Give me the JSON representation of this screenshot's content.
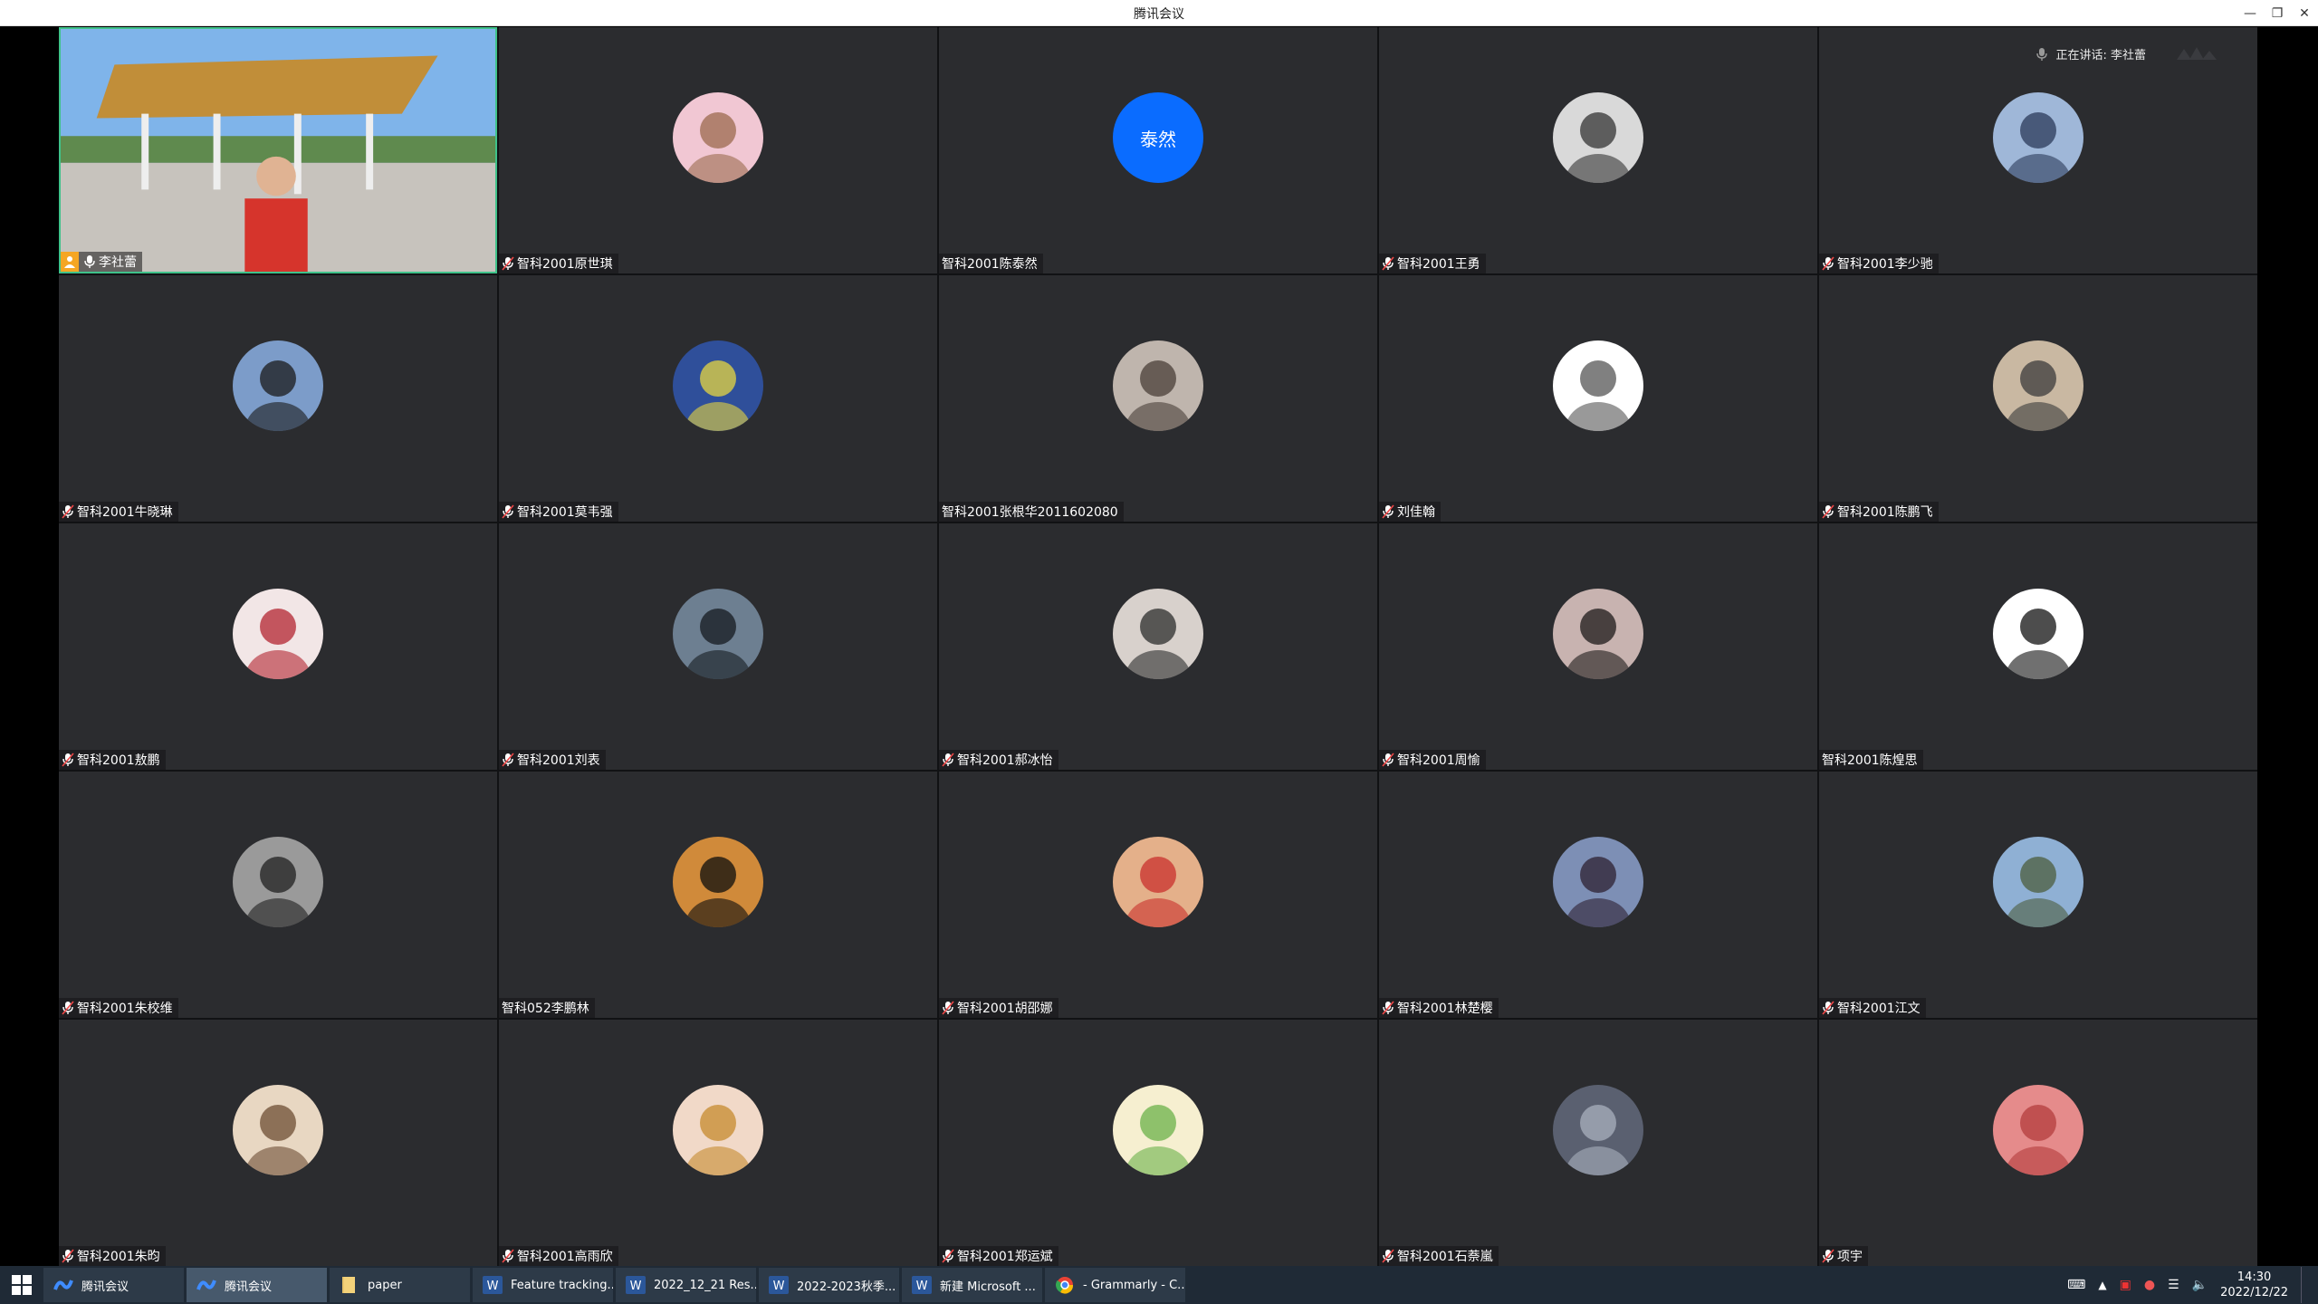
{
  "window": {
    "title": "腾讯会议"
  },
  "speaking": {
    "label": "正在讲话: 李社蕾"
  },
  "participants": [
    {
      "name": "李社蕾",
      "kind": "video",
      "host": true,
      "mic": true
    },
    {
      "name": "智科2001原世琪",
      "kind": "avatar",
      "mic": true,
      "colors": [
        "#f1c7d3",
        "#9b6a4e"
      ]
    },
    {
      "name": "智科2001陈泰然",
      "kind": "text",
      "mic": false,
      "initials": "泰然"
    },
    {
      "name": "智科2001王勇",
      "kind": "avatar",
      "mic": true,
      "colors": [
        "#d9d9d9",
        "#333333"
      ]
    },
    {
      "name": "智科2001李少驰",
      "kind": "avatar",
      "mic": true,
      "colors": [
        "#9fb7d8",
        "#2b3a5a"
      ]
    },
    {
      "name": "智科2001牛晓琳",
      "kind": "avatar",
      "mic": true,
      "colors": [
        "#7c9cc9",
        "#1b1b1b"
      ]
    },
    {
      "name": "智科2001莫韦强",
      "kind": "avatar",
      "mic": true,
      "colors": [
        "#2f4f9a",
        "#e7d640"
      ]
    },
    {
      "name": "智科2001张根华2011602080",
      "kind": "avatar",
      "mic": false,
      "colors": [
        "#bfb5ad",
        "#4a3f38"
      ]
    },
    {
      "name": "刘佳翰",
      "kind": "avatar",
      "mic": true,
      "colors": [
        "#ffffff",
        "#555555"
      ]
    },
    {
      "name": "智科2001陈鹏飞",
      "kind": "avatar",
      "mic": true,
      "colors": [
        "#c9b8a2",
        "#3b3b3b"
      ]
    },
    {
      "name": "智科2001敖鹏",
      "kind": "avatar",
      "mic": true,
      "colors": [
        "#f2e6e6",
        "#b32430"
      ]
    },
    {
      "name": "智科2001刘表",
      "kind": "avatar",
      "mic": true,
      "colors": [
        "#6d7f91",
        "#151a20"
      ]
    },
    {
      "name": "智科2001郝冰怡",
      "kind": "avatar",
      "mic": true,
      "colors": [
        "#d8d1cc",
        "#2c2c2c"
      ]
    },
    {
      "name": "智科2001周愉",
      "kind": "avatar",
      "mic": true,
      "colors": [
        "#c8b3b0",
        "#1e1a1a"
      ]
    },
    {
      "name": "智科2001陈煌思",
      "kind": "avatar",
      "mic": false,
      "colors": [
        "#ffffff",
        "#111111"
      ]
    },
    {
      "name": "智科2001朱校维",
      "kind": "avatar",
      "mic": true,
      "colors": [
        "#9a9a9a",
        "#1f1f1f"
      ]
    },
    {
      "name": "智科052李鹏林",
      "kind": "avatar",
      "mic": false,
      "colors": [
        "#d08a3a",
        "#0d0d0d"
      ]
    },
    {
      "name": "智科2001胡邵娜",
      "kind": "avatar",
      "mic": true,
      "colors": [
        "#e4b08a",
        "#c9302c"
      ]
    },
    {
      "name": "智科2001林楚樱",
      "kind": "avatar",
      "mic": true,
      "colors": [
        "#7d8fb5",
        "#2d2032"
      ]
    },
    {
      "name": "智科2001江文",
      "kind": "avatar",
      "mic": true,
      "colors": [
        "#8fb0d4",
        "#4c5e3e"
      ]
    },
    {
      "name": "智科2001朱昀",
      "kind": "avatar",
      "mic": true,
      "colors": [
        "#e8d7c2",
        "#6d4d33"
      ]
    },
    {
      "name": "智科2001高雨欣",
      "kind": "avatar",
      "mic": true,
      "colors": [
        "#f1d9c8",
        "#c68a2e"
      ]
    },
    {
      "name": "智科2001郑运斌",
      "kind": "avatar",
      "mic": true,
      "colors": [
        "#f6efd0",
        "#6bb14a"
      ]
    },
    {
      "name": "智科2001石萘嵐",
      "kind": "avatar",
      "mic": true,
      "colors": [
        "#5a6070",
        "#a9b0bd"
      ]
    },
    {
      "name": "项宇",
      "kind": "avatar",
      "mic": true,
      "colors": [
        "#e58b8b",
        "#b33c3c"
      ]
    }
  ],
  "taskbar": {
    "items": [
      {
        "label": "腾讯会议",
        "icon": "tencent-meeting-icon",
        "active": false
      },
      {
        "label": "腾讯会议",
        "icon": "tencent-meeting-icon",
        "active": true
      },
      {
        "label": "paper",
        "icon": "folder-icon",
        "active": false
      },
      {
        "label": "Feature tracking...",
        "icon": "word-icon",
        "active": false
      },
      {
        "label": "2022_12_21 Res...",
        "icon": "word-icon",
        "active": false
      },
      {
        "label": "2022-2023秋季...",
        "icon": "word-icon",
        "active": false
      },
      {
        "label": "新建 Microsoft ...",
        "icon": "word-icon",
        "active": false
      },
      {
        "label": "- Grammarly - C...",
        "icon": "chrome-icon",
        "active": false
      }
    ],
    "clock_time": "14:30",
    "clock_date": "2022/12/22"
  },
  "colors": {
    "accent": "#0a6cff",
    "host": "#f5a623",
    "tile_bg": "#2b2c2f",
    "video_border": "#3fc28a"
  }
}
